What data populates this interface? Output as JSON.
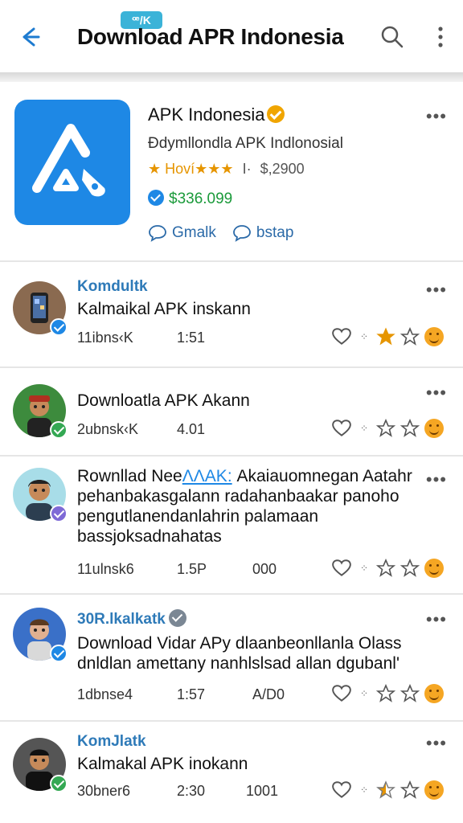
{
  "header": {
    "tag": "ꟹ/K",
    "title": "Download APR Indonesia",
    "icons": [
      "back-arrow-icon",
      "search-icon",
      "more-vertical-icon"
    ]
  },
  "app": {
    "name": "APK Indonesia",
    "developer": "Ðdymllondla APK Indlonosial",
    "rating_label": "★ Hoví★★★",
    "rating_sep": "I·",
    "downloads": "$,2900",
    "price": "$336.099",
    "actions": [
      {
        "icon": "chat-bubble-icon",
        "label": "Gmalk"
      },
      {
        "icon": "chat-bubble-icon",
        "label": "bstap"
      }
    ],
    "colors": {
      "icon_bg": "#1e88e5",
      "price": "#1a9a3a"
    }
  },
  "posts": [
    {
      "author": "Komdultk",
      "text_lines": [
        "Kalmaikal APK inskann"
      ],
      "meta": [
        "11ibns‹K",
        "1:51",
        ""
      ],
      "badge_color": "#1e88e5",
      "star_filled": 1
    },
    {
      "author": "",
      "text_lines": [
        "Downloatla APK Akann"
      ],
      "meta": [
        "2ubnsk‹K",
        "4.01",
        ""
      ],
      "badge_color": "#34a853",
      "star_filled": 0
    },
    {
      "author": "",
      "text_lines": [
        "Rownllad Nee",
        "pehanbakasgalann radahanbaakar panoho",
        "pengutlanendanlahrin palamaan",
        "bassjoksadnahatas"
      ],
      "first_line_link": "ΛΛΑΚ:",
      "first_line_rest": " Akaiauomnegan Aatahr",
      "meta": [
        "11ulnsk6",
        "1.5P",
        "000"
      ],
      "badge_color": "#7e6ad6",
      "star_filled": 0
    },
    {
      "author": "30R.lkalkatk",
      "text_lines": [
        "Download Vidar APy dlaanbeonllanla Olass",
        "dnldlan amettany nanhlslsad allan dgubanl'"
      ],
      "meta": [
        "1dbnse4",
        "1:57",
        "A/D0"
      ],
      "badge_color": "#1e88e5",
      "star_filled": 0
    },
    {
      "author": "KomJlatk",
      "text_lines": [
        "Kalmakal APK inokann"
      ],
      "meta": [
        "30bner6",
        "2:30",
        "1001"
      ],
      "badge_color": "#34a853",
      "star_filled": 1
    }
  ]
}
